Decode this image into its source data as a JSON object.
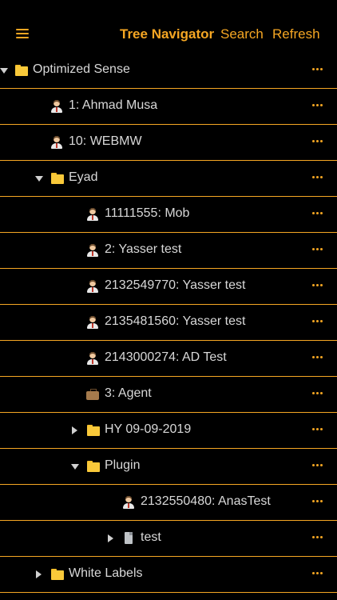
{
  "header": {
    "title": "Tree Navigator",
    "search_label": "Search",
    "refresh_label": "Refresh",
    "menu_icon": "hamburger-icon"
  },
  "colors": {
    "accent": "#f5a623",
    "background": "#000000",
    "text": "#d8d8d8",
    "divider": "#f5a623"
  },
  "tree": {
    "rows": [
      {
        "label": "Optimized Sense",
        "icon": "folder-icon",
        "toggle": "expanded"
      },
      {
        "label": "1: Ahmad Musa",
        "icon": "person-icon",
        "toggle": "none"
      },
      {
        "label": "10: WEBMW",
        "icon": "person-icon",
        "toggle": "none"
      },
      {
        "label": "Eyad",
        "icon": "folder-icon",
        "toggle": "expanded"
      },
      {
        "label": "11111555: Mob",
        "icon": "person-icon",
        "toggle": "none"
      },
      {
        "label": "2: Yasser test",
        "icon": "person-icon",
        "toggle": "none"
      },
      {
        "label": "2132549770: Yasser test",
        "icon": "person-icon",
        "toggle": "none"
      },
      {
        "label": "2135481560: Yasser test",
        "icon": "person-icon",
        "toggle": "none"
      },
      {
        "label": "2143000274: AD Test",
        "icon": "person-icon",
        "toggle": "none"
      },
      {
        "label": "3: Agent",
        "icon": "briefcase-icon",
        "toggle": "none"
      },
      {
        "label": "HY 09-09-2019",
        "icon": "folder-icon",
        "toggle": "collapsed"
      },
      {
        "label": "Plugin",
        "icon": "folder-icon",
        "toggle": "expanded"
      },
      {
        "label": "2132550480: AnasTest",
        "icon": "person-icon",
        "toggle": "none"
      },
      {
        "label": "test",
        "icon": "document-icon",
        "toggle": "collapsed"
      },
      {
        "label": "White Labels",
        "icon": "folder-icon",
        "toggle": "collapsed"
      }
    ],
    "more_icon": "more-options-icon"
  }
}
